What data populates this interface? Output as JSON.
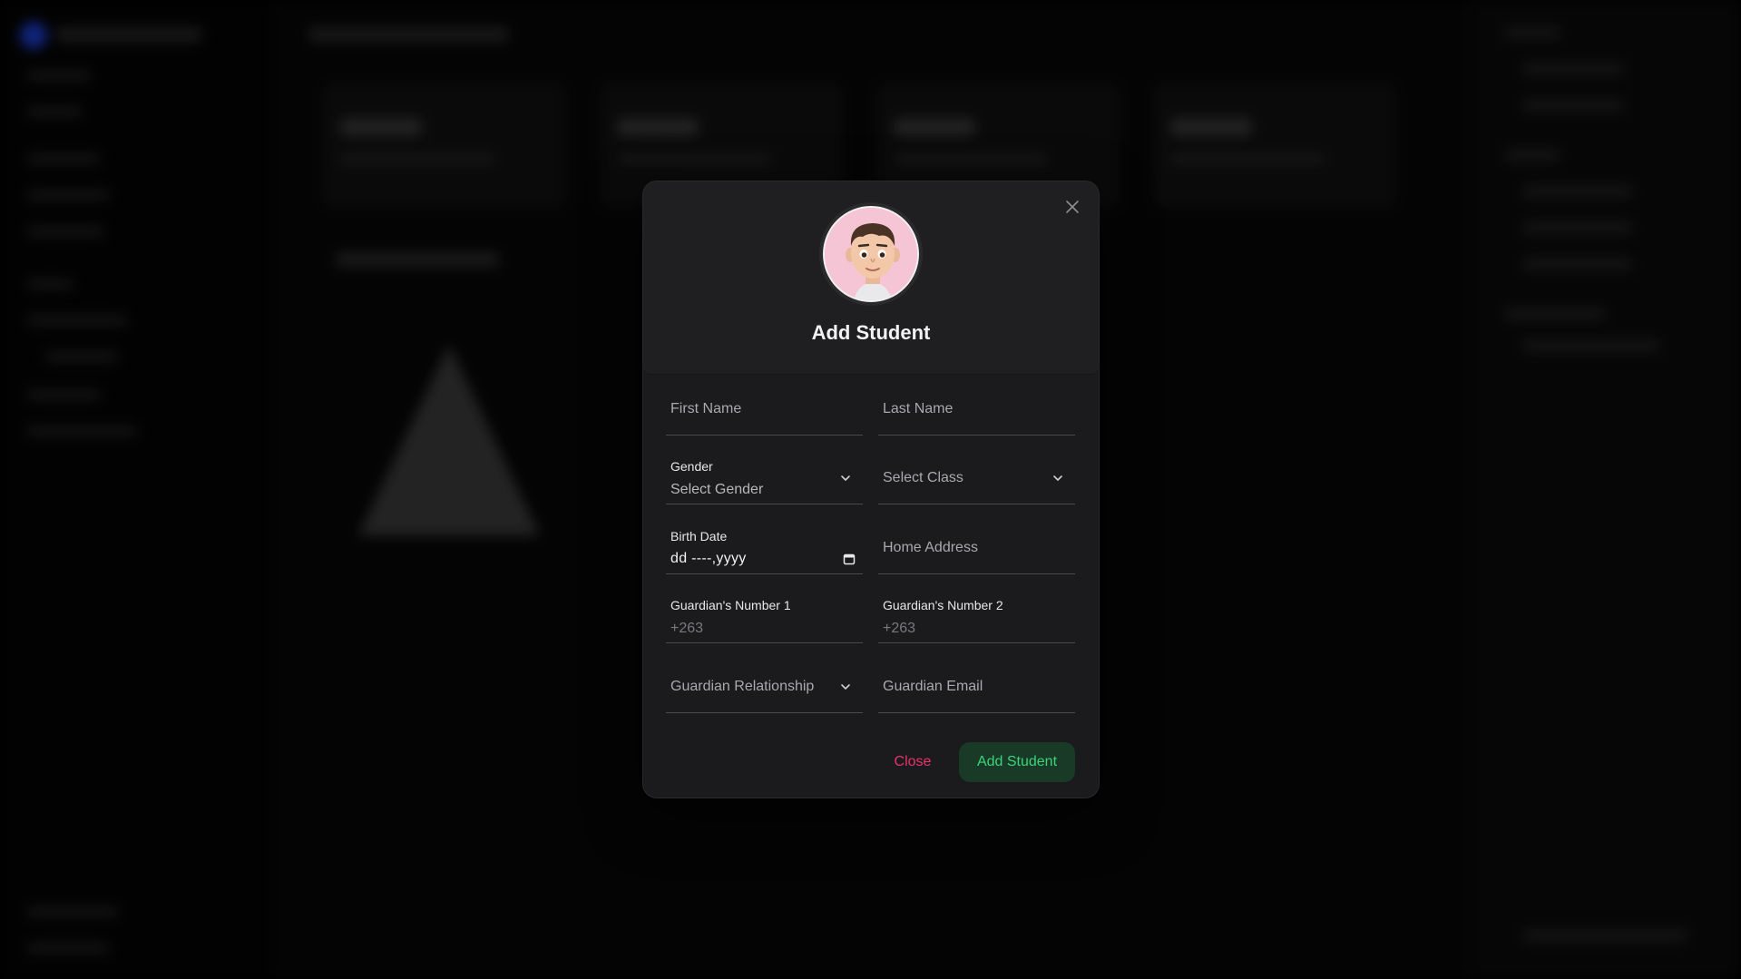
{
  "modal": {
    "title": "Add Student",
    "fields": {
      "first_name": {
        "placeholder": "First Name"
      },
      "last_name": {
        "placeholder": "Last Name"
      },
      "gender": {
        "label": "Gender",
        "value": "Select Gender"
      },
      "class": {
        "value": "Select Class"
      },
      "birth_date": {
        "label": "Birth Date",
        "value": "dd ----,yyyy"
      },
      "home_address": {
        "placeholder": "Home Address"
      },
      "guardian_number_1": {
        "label": "Guardian's Number 1",
        "value": "+263"
      },
      "guardian_number_2": {
        "label": "Guardian's Number 2",
        "value": "+263"
      },
      "guardian_relationship": {
        "value": "Guardian Relationship"
      },
      "guardian_email": {
        "placeholder": "Guardian Email"
      }
    },
    "buttons": {
      "close_label": "Close",
      "add_label": "Add Student"
    }
  },
  "icons": {
    "close": "close-icon",
    "chevron": "chevron-down-icon",
    "calendar": "calendar-icon",
    "avatar": "avatar"
  },
  "colors": {
    "modal_bg": "#1b1b1d",
    "close_text": "#e8336b",
    "add_bg": "#183a26",
    "add_text": "#3ed37a",
    "avatar_bg": "#f6c5d5"
  }
}
